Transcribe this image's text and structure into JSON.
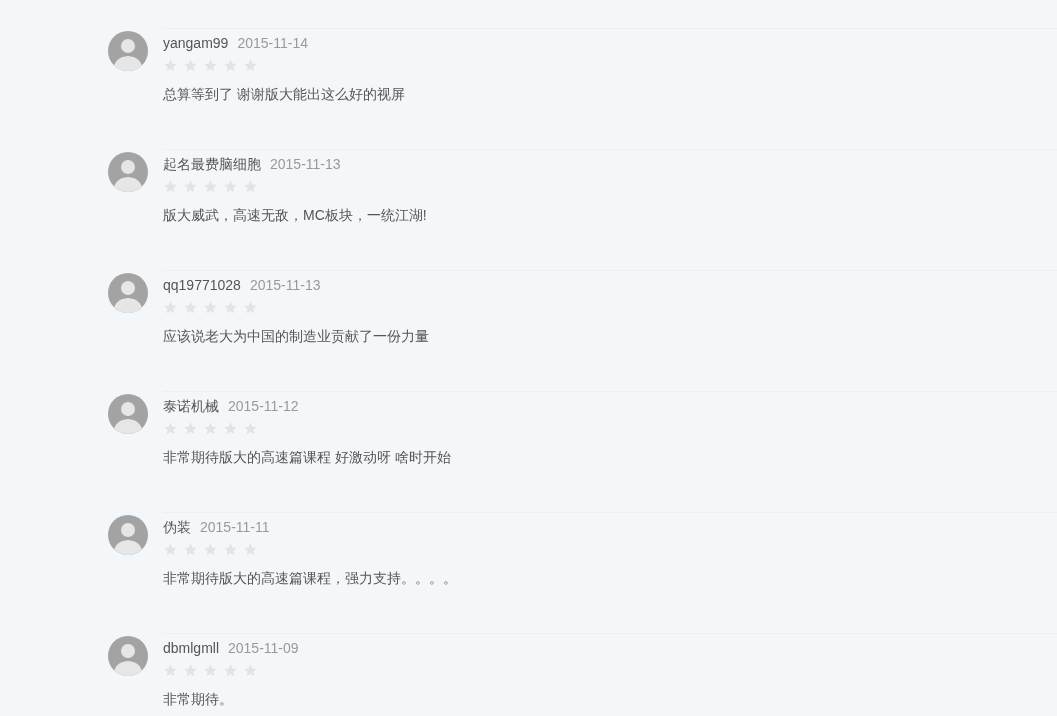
{
  "comments": [
    {
      "user": "yangam99",
      "date": "2015-11-14",
      "stars": 0,
      "text": "总算等到了 谢谢版大能出这么好的视屏"
    },
    {
      "user": "起名最费脑细胞",
      "date": "2015-11-13",
      "stars": 0,
      "text": "版大威武，高速无敌，MC板块，一统江湖!"
    },
    {
      "user": "qq19771028",
      "date": "2015-11-13",
      "stars": 0,
      "text": "应该说老大为中国的制造业贡献了一份力量"
    },
    {
      "user": "泰诺机械",
      "date": "2015-11-12",
      "stars": 0,
      "text": "非常期待版大的高速篇课程 好激动呀 啥时开始"
    },
    {
      "user": "伪装",
      "date": "2015-11-11",
      "stars": 0,
      "text": "非常期待版大的高速篇课程，强力支持。。。。"
    },
    {
      "user": "dbmlgmll",
      "date": "2015-11-09",
      "stars": 0,
      "text": "非常期待。"
    }
  ]
}
